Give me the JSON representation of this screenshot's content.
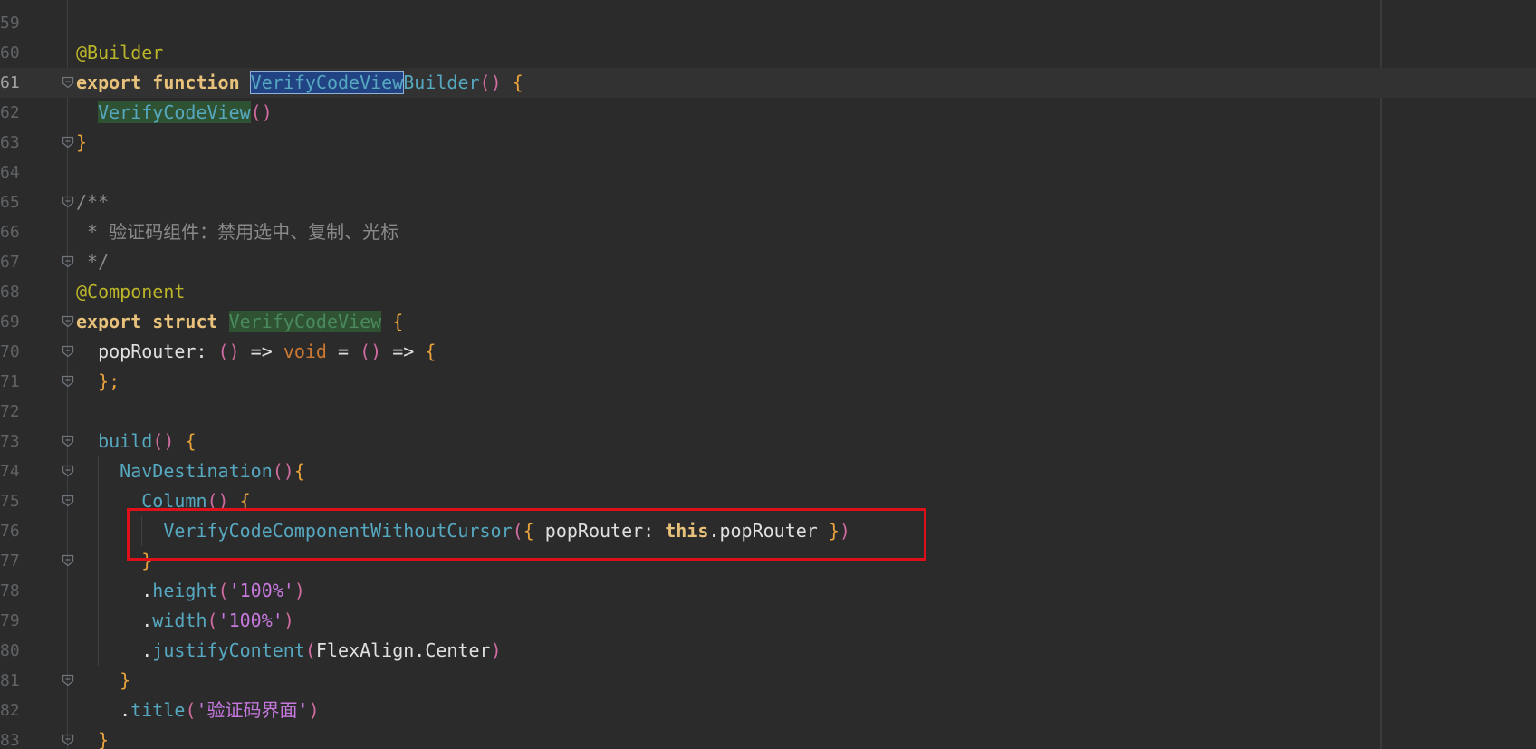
{
  "editor": {
    "lines": [
      {
        "ln": "59",
        "segments": []
      },
      {
        "ln": "60",
        "segments": [
          {
            "t": "@Builder",
            "c": "ann"
          }
        ]
      },
      {
        "ln": "61",
        "current": true,
        "segments": [
          {
            "t": "export",
            "c": "kw"
          },
          {
            "t": " ",
            "c": "plain"
          },
          {
            "t": "function",
            "c": "kw"
          },
          {
            "t": " ",
            "c": "plain"
          },
          {
            "t": "VerifyCodeView",
            "c": "hl-sel"
          },
          {
            "t": "Builder",
            "c": "fn"
          },
          {
            "t": "()",
            "c": "p2"
          },
          {
            "t": " ",
            "c": "plain"
          },
          {
            "t": "{",
            "c": "p1"
          }
        ]
      },
      {
        "ln": "62",
        "segments": [
          {
            "t": "  ",
            "c": "plain"
          },
          {
            "t": "VerifyCodeView",
            "c": "hl-green"
          },
          {
            "t": "()",
            "c": "p2"
          }
        ]
      },
      {
        "ln": "63",
        "segments": [
          {
            "t": "}",
            "c": "p1"
          }
        ]
      },
      {
        "ln": "64",
        "segments": []
      },
      {
        "ln": "65",
        "segments": [
          {
            "t": "/**",
            "c": "cmt"
          }
        ]
      },
      {
        "ln": "66",
        "segments": [
          {
            "t": " * 验证码组件：禁用选中、复制、光标",
            "c": "cmt"
          }
        ]
      },
      {
        "ln": "67",
        "segments": [
          {
            "t": " */",
            "c": "cmt"
          }
        ]
      },
      {
        "ln": "68",
        "segments": [
          {
            "t": "@Component",
            "c": "ann"
          }
        ]
      },
      {
        "ln": "69",
        "segments": [
          {
            "t": "export",
            "c": "kw"
          },
          {
            "t": " ",
            "c": "plain"
          },
          {
            "t": "struct",
            "c": "kw"
          },
          {
            "t": " ",
            "c": "plain"
          },
          {
            "t": "VerifyCodeView",
            "c": "hl-green-dim"
          },
          {
            "t": " ",
            "c": "plain"
          },
          {
            "t": "{",
            "c": "p1"
          }
        ]
      },
      {
        "ln": "70",
        "segments": [
          {
            "t": "  popRouter",
            "c": "plain"
          },
          {
            "t": ": ",
            "c": "plain"
          },
          {
            "t": "()",
            "c": "p2"
          },
          {
            "t": " => ",
            "c": "plain"
          },
          {
            "t": "void",
            "c": "kwt"
          },
          {
            "t": " = ",
            "c": "plain"
          },
          {
            "t": "()",
            "c": "p2"
          },
          {
            "t": " => ",
            "c": "plain"
          },
          {
            "t": "{",
            "c": "p1"
          }
        ]
      },
      {
        "ln": "71",
        "segments": [
          {
            "t": "  ",
            "c": "plain"
          },
          {
            "t": "};",
            "c": "p1"
          }
        ]
      },
      {
        "ln": "72",
        "segments": []
      },
      {
        "ln": "73",
        "segments": [
          {
            "t": "  ",
            "c": "plain"
          },
          {
            "t": "build",
            "c": "fn"
          },
          {
            "t": "()",
            "c": "p2"
          },
          {
            "t": " ",
            "c": "plain"
          },
          {
            "t": "{",
            "c": "p1"
          }
        ]
      },
      {
        "ln": "74",
        "segments": [
          {
            "t": "    ",
            "c": "plain"
          },
          {
            "t": "NavDestination",
            "c": "fn"
          },
          {
            "t": "()",
            "c": "p2"
          },
          {
            "t": "{",
            "c": "p1"
          }
        ]
      },
      {
        "ln": "75",
        "segments": [
          {
            "t": "      ",
            "c": "plain"
          },
          {
            "t": "Column",
            "c": "fn"
          },
          {
            "t": "()",
            "c": "p2"
          },
          {
            "t": " ",
            "c": "plain"
          },
          {
            "t": "{",
            "c": "p1"
          }
        ]
      },
      {
        "ln": "76",
        "segments": [
          {
            "t": "        ",
            "c": "plain"
          },
          {
            "t": "VerifyCodeComponentWithoutCursor",
            "c": "fn"
          },
          {
            "t": "(",
            "c": "p2"
          },
          {
            "t": "{",
            "c": "p1"
          },
          {
            "t": " popRouter: ",
            "c": "plain"
          },
          {
            "t": "this",
            "c": "kw"
          },
          {
            "t": ".popRouter ",
            "c": "plain"
          },
          {
            "t": "}",
            "c": "p1"
          },
          {
            "t": ")",
            "c": "p2"
          }
        ]
      },
      {
        "ln": "77",
        "segments": [
          {
            "t": "      ",
            "c": "plain"
          },
          {
            "t": "}",
            "c": "p1"
          }
        ]
      },
      {
        "ln": "78",
        "segments": [
          {
            "t": "      .",
            "c": "plain"
          },
          {
            "t": "height",
            "c": "fn"
          },
          {
            "t": "(",
            "c": "p2"
          },
          {
            "t": "'100%'",
            "c": "str"
          },
          {
            "t": ")",
            "c": "p2"
          }
        ]
      },
      {
        "ln": "79",
        "segments": [
          {
            "t": "      .",
            "c": "plain"
          },
          {
            "t": "width",
            "c": "fn"
          },
          {
            "t": "(",
            "c": "p2"
          },
          {
            "t": "'100%'",
            "c": "str"
          },
          {
            "t": ")",
            "c": "p2"
          }
        ]
      },
      {
        "ln": "80",
        "segments": [
          {
            "t": "      .",
            "c": "plain"
          },
          {
            "t": "justifyContent",
            "c": "fn"
          },
          {
            "t": "(",
            "c": "p2"
          },
          {
            "t": "FlexAlign.Center",
            "c": "plain"
          },
          {
            "t": ")",
            "c": "p2"
          }
        ]
      },
      {
        "ln": "81",
        "segments": [
          {
            "t": "    ",
            "c": "plain"
          },
          {
            "t": "}",
            "c": "p1"
          }
        ]
      },
      {
        "ln": "82",
        "segments": [
          {
            "t": "    .",
            "c": "plain"
          },
          {
            "t": "title",
            "c": "fn"
          },
          {
            "t": "(",
            "c": "p2"
          },
          {
            "t": "'验证码界面'",
            "c": "str"
          },
          {
            "t": ")",
            "c": "p2"
          }
        ]
      },
      {
        "ln": "83",
        "segments": [
          {
            "t": "  ",
            "c": "plain"
          },
          {
            "t": "}",
            "c": "p1"
          }
        ]
      }
    ],
    "fold_lines": [
      "61",
      "63",
      "65",
      "67",
      "69",
      "70",
      "71",
      "73",
      "74",
      "75",
      "77",
      "81",
      "83"
    ],
    "colors": {
      "background": "#2b2b2b",
      "current_line": "#323232",
      "keyword": "#e8c17a",
      "function": "#56a8c0",
      "annotation": "#bbb529",
      "string": "#c678dd",
      "comment": "#8a8a8a",
      "highlight_box": "#e0101a"
    }
  }
}
